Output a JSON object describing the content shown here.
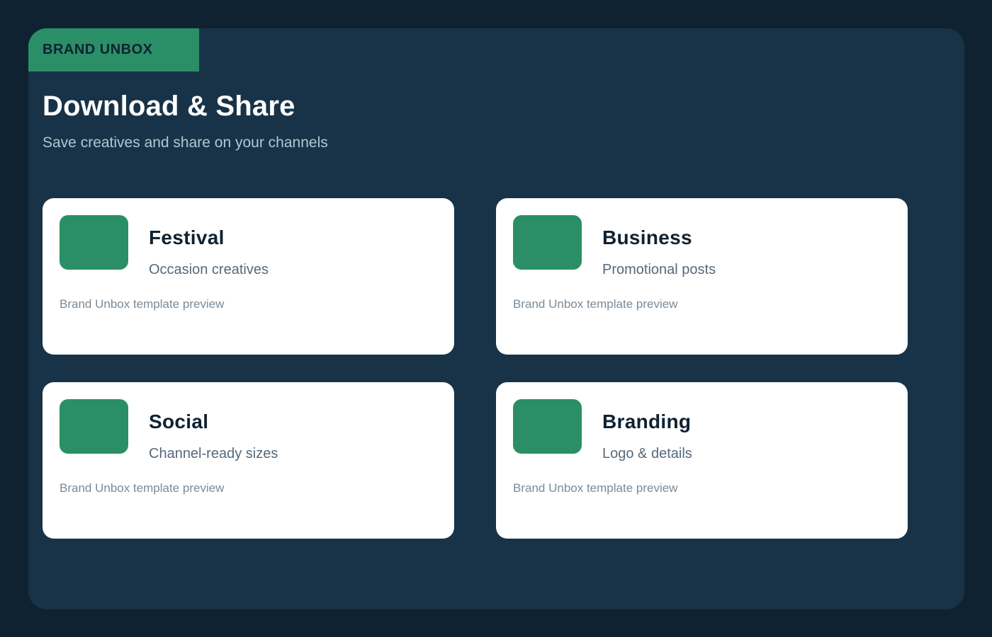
{
  "brand": {
    "label": "BRAND UNBOX"
  },
  "header": {
    "title": "Download & Share",
    "subtitle": "Save creatives and share on your channels"
  },
  "cards": [
    {
      "title": "Festival",
      "subtitle": "Occasion creatives",
      "note": "Brand Unbox template preview"
    },
    {
      "title": "Business",
      "subtitle": "Promotional posts",
      "note": "Brand Unbox template preview"
    },
    {
      "title": "Social",
      "subtitle": "Channel-ready sizes",
      "note": "Brand Unbox template preview"
    },
    {
      "title": "Branding",
      "subtitle": "Logo & details",
      "note": "Brand Unbox template preview"
    }
  ],
  "colors": {
    "background": "#0f2231",
    "panel": "#183347",
    "accent": "#2a8f66",
    "card": "#ffffff"
  }
}
